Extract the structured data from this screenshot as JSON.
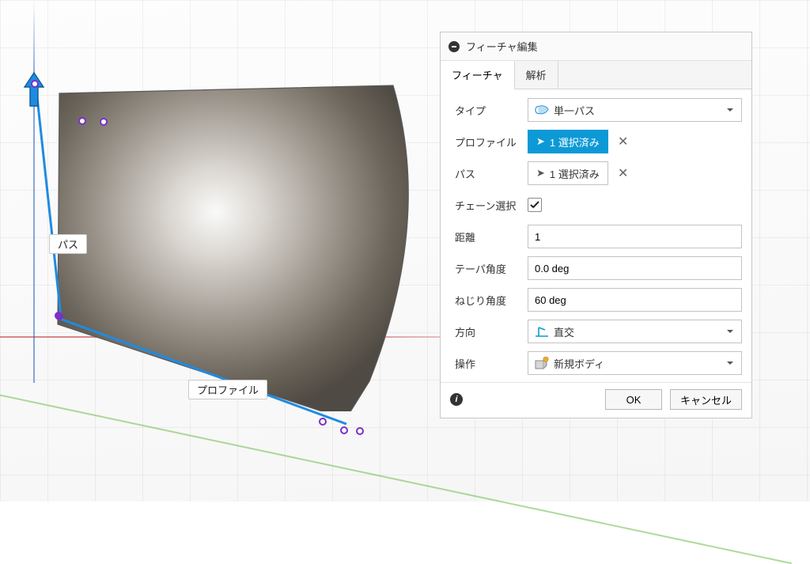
{
  "panel": {
    "title": "フィーチャ編集",
    "tabs": {
      "feature": "フィーチャ",
      "analysis": "解析"
    },
    "labels": {
      "type": "タイプ",
      "profile": "プロファイル",
      "path": "パス",
      "chain": "チェーン選択",
      "distance": "距離",
      "taper": "テーパ角度",
      "twist": "ねじり角度",
      "direction": "方向",
      "operation": "操作"
    },
    "values": {
      "type": "単一パス",
      "profile_selected": "1 選択済み",
      "path_selected": "1 選択済み",
      "chain": true,
      "distance": "1",
      "taper": "0.0 deg",
      "twist": "60 deg",
      "direction": "直交",
      "operation": "新規ボディ"
    },
    "buttons": {
      "ok": "OK",
      "cancel": "キャンセル"
    }
  },
  "viewport": {
    "path_tag": "パス",
    "profile_tag": "プロファイル"
  }
}
